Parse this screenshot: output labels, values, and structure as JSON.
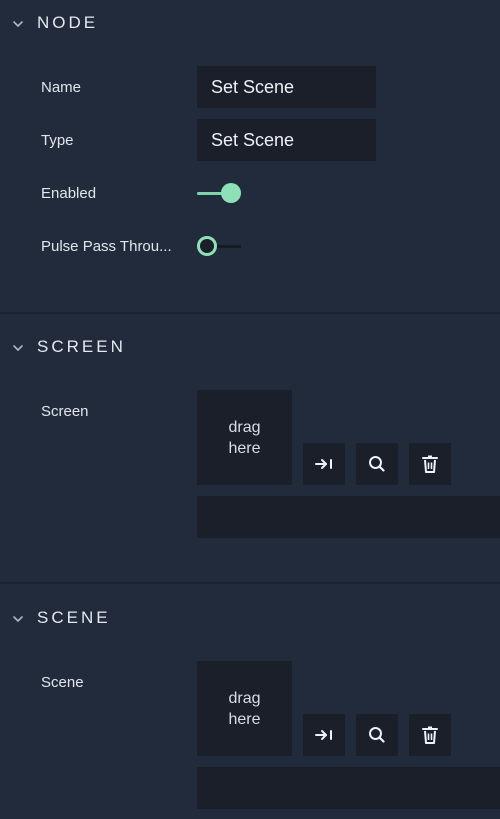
{
  "node": {
    "title": "NODE",
    "name_label": "Name",
    "name_value": "Set Scene",
    "type_label": "Type",
    "type_value": "Set Scene",
    "enabled_label": "Enabled",
    "enabled_on": true,
    "pulse_label": "Pulse Pass Throu...",
    "pulse_on": false
  },
  "screen": {
    "title": "SCREEN",
    "field_label": "Screen",
    "drop_text": "drag here",
    "path_value": ""
  },
  "scene": {
    "title": "SCENE",
    "field_label": "Scene",
    "drop_text": "drag here",
    "path_value": ""
  },
  "icons": {
    "collapse": "chevron-down-icon",
    "select": "arrow-to-line-icon",
    "find": "search-icon",
    "clear": "trash-icon"
  },
  "colors": {
    "background": "#222b3b",
    "field": "#1a1f2a",
    "accent": "#8ee0b9",
    "text": "#e1e5ec"
  }
}
